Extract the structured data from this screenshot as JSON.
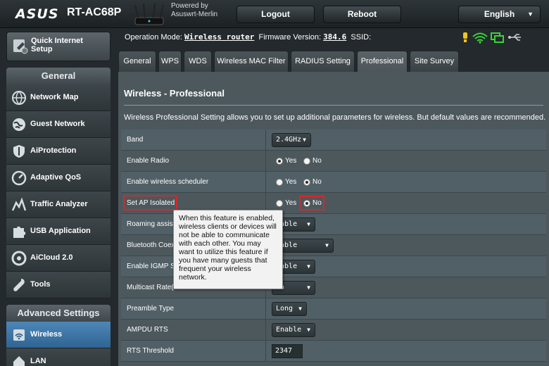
{
  "header": {
    "logo": "ASUS",
    "model": "RT-AC68P",
    "powered_by_line1": "Powered by",
    "powered_by_line2": "Asuswrt-Merlin",
    "logout_label": "Logout",
    "reboot_label": "Reboot",
    "language": "English"
  },
  "sidebar": {
    "quick_setup_line1": "Quick Internet",
    "quick_setup_line2": "Setup",
    "general_header": "General",
    "general_items": [
      {
        "label": "Network Map",
        "icon": "network-map-icon"
      },
      {
        "label": "Guest Network",
        "icon": "globe-icon"
      },
      {
        "label": "AiProtection",
        "icon": "shield-icon"
      },
      {
        "label": "Adaptive QoS",
        "icon": "gauge-icon"
      },
      {
        "label": "Traffic Analyzer",
        "icon": "chart-icon"
      },
      {
        "label": "USB Application",
        "icon": "puzzle-icon"
      },
      {
        "label": "AiCloud 2.0",
        "icon": "cloud-icon"
      },
      {
        "label": "Tools",
        "icon": "wrench-icon"
      }
    ],
    "advanced_header": "Advanced Settings",
    "advanced_items": [
      {
        "label": "Wireless",
        "icon": "wifi-icon",
        "active": true
      },
      {
        "label": "LAN",
        "icon": "home-icon",
        "active": false
      }
    ]
  },
  "info": {
    "op_mode_label": "Operation Mode:",
    "op_mode_value": "Wireless router",
    "firmware_label": "Firmware Version:",
    "firmware_value": "384.6",
    "ssid_label": "SSID:"
  },
  "tabs": [
    {
      "label": "General",
      "active": false
    },
    {
      "label": "WPS",
      "active": false
    },
    {
      "label": "WDS",
      "active": false
    },
    {
      "label": "Wireless MAC Filter",
      "active": false
    },
    {
      "label": "RADIUS Setting",
      "active": false
    },
    {
      "label": "Professional",
      "active": true
    },
    {
      "label": "Site Survey",
      "active": false
    }
  ],
  "main": {
    "title": "Wireless - Professional",
    "description": "Wireless Professional Setting allows you to set up additional parameters for wireless. But default values are recommended.",
    "yes": "Yes",
    "no": "No",
    "rows": [
      {
        "label": "Band",
        "select": "2.4GHz"
      },
      {
        "label": "Enable Radio",
        "radio": "Yes"
      },
      {
        "label": "Enable wireless scheduler",
        "radio": "No"
      },
      {
        "label": "Set AP Isolated",
        "radio": "No"
      },
      {
        "label": "Roaming assist",
        "select": "sable"
      },
      {
        "label": "Bluetooth Coex",
        "select": "sable"
      },
      {
        "label": "Enable IGMP S",
        "select": "sable"
      },
      {
        "label": "Multicast Rate(",
        "select": "to"
      },
      {
        "label": "Preamble Type",
        "select": "Long"
      },
      {
        "label": "AMPDU RTS",
        "select": "Enable"
      },
      {
        "label": "RTS Threshold",
        "text": "2347"
      }
    ],
    "tooltip": "When this feature is enabled, wireless clients or devices will not be able to communicate with each other. You may want to utilize this feature if you have many guests that frequent your wireless network."
  },
  "colors": {
    "highlight_red": "#d9262a",
    "active_menu": "#3a75a6"
  }
}
